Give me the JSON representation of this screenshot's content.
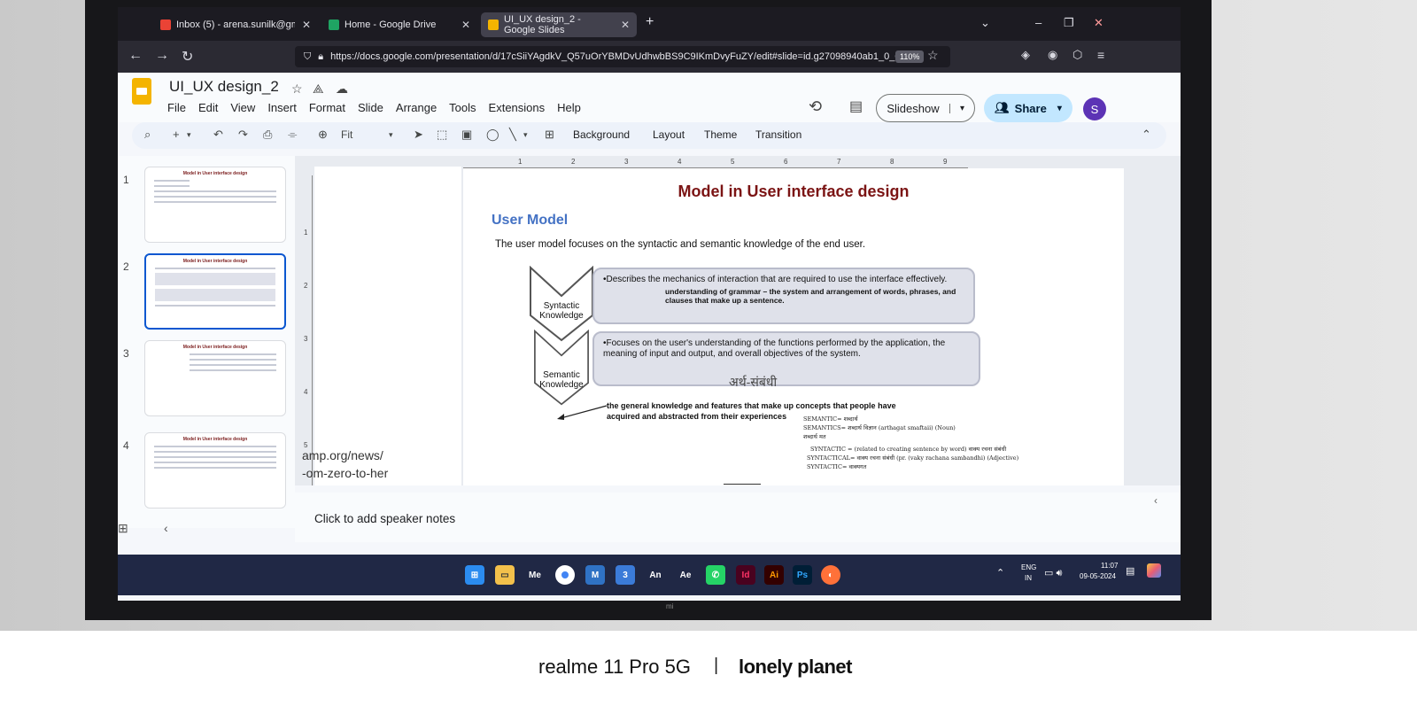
{
  "browser": {
    "tabs": [
      {
        "label": "Inbox (5) - arena.sunilk@gmail.c",
        "close": "✕"
      },
      {
        "label": "Home - Google Drive",
        "close": "✕"
      },
      {
        "label": "UI_UX design_2 - Google Slides",
        "close": "✕"
      }
    ],
    "new_tab": "+",
    "url": "https://docs.google.com/presentation/d/17cSiiYAgdkV_Q57uOrYBMDvUdhwbBS9C9IKmDvyFuZY/edit#slide=id.g27098940ab1_0_0",
    "zoom": "110%"
  },
  "app": {
    "title": "UI_UX design_2",
    "menus": [
      "File",
      "Edit",
      "View",
      "Insert",
      "Format",
      "Slide",
      "Arrange",
      "Tools",
      "Extensions",
      "Help"
    ],
    "slideshow_label": "Slideshow",
    "share_label": "Share",
    "avatar_initial": "S"
  },
  "toolbar": {
    "zoom_value": "Fit",
    "background_label": "Background",
    "layout_label": "Layout",
    "theme_label": "Theme",
    "transition_label": "Transition"
  },
  "filmstrip": {
    "thumbs": [
      {
        "number": "1",
        "title": "Model in User interface design"
      },
      {
        "number": "2",
        "title": "Model in User interface design"
      },
      {
        "number": "3",
        "title": "Model in User interface design"
      },
      {
        "number": "4",
        "title": "Model in User interface design"
      }
    ]
  },
  "rulers": {
    "top": [
      "1",
      "2",
      "3",
      "4",
      "5",
      "6",
      "7",
      "8",
      "9"
    ],
    "left": [
      "1",
      "2",
      "3",
      "4",
      "5"
    ]
  },
  "canvas": {
    "url_snippet_1": "amp.org/news/",
    "url_snippet_2": "-om-zero-to-her"
  },
  "slide": {
    "title": "Model in User interface design",
    "subtitle": "User Model",
    "lead": "The user model focuses on the syntactic and semantic knowledge of the end user.",
    "syntactic_label": "Syntactic Knowledge",
    "syntactic_text": "•Describes the mechanics of interaction that are required to use the interface effectively.",
    "syntactic_note": "understanding of grammar – the system and arrangement of words, phrases, and clauses that make up a sentence.",
    "semantic_label": "Semantic Knowledge",
    "semantic_text": "•Focuses on the user's understanding of the functions performed by the application, the meaning of input and output, and overall objectives of the system.",
    "hindi_word": "अर्थ-संबंधी",
    "arrow_note": "the general knowledge and features that make up concepts that people have acquired and abstracted from their experiences",
    "handwritten": [
      "SEMANTIC= शब्दार्थ",
      "SEMANTICS= शब्दार्थ विज्ञान (arthagat smaftaii) (Noun)",
      "शब्दार्थ मत",
      "SYNTACTIC = (related to creating sentence by word) वाक्य रचना संबंधी",
      "SYNTACTICAL= वाक्य रचना संबंधी (pr. (vaky rachana sambandhi) (Adjective)",
      "SYNTACTIC= वाक्यगत"
    ]
  },
  "notes": {
    "placeholder": "Click to add speaker notes"
  },
  "taskbar": {
    "apps": [
      "Me",
      "An",
      "Ae",
      "Id",
      "Ai",
      "Ps"
    ],
    "lang_1": "ENG",
    "lang_2": "IN",
    "time": "11:07",
    "date": "09-05-2024"
  },
  "caption": {
    "device": "realme 11 Pro 5G",
    "separator": "|",
    "brand": "lonely planet"
  },
  "colors": {
    "slide_title": "#7b1414",
    "subtitle": "#4472c4",
    "share_bg": "#c2e7ff",
    "avatar_bg": "#5c33b5"
  }
}
